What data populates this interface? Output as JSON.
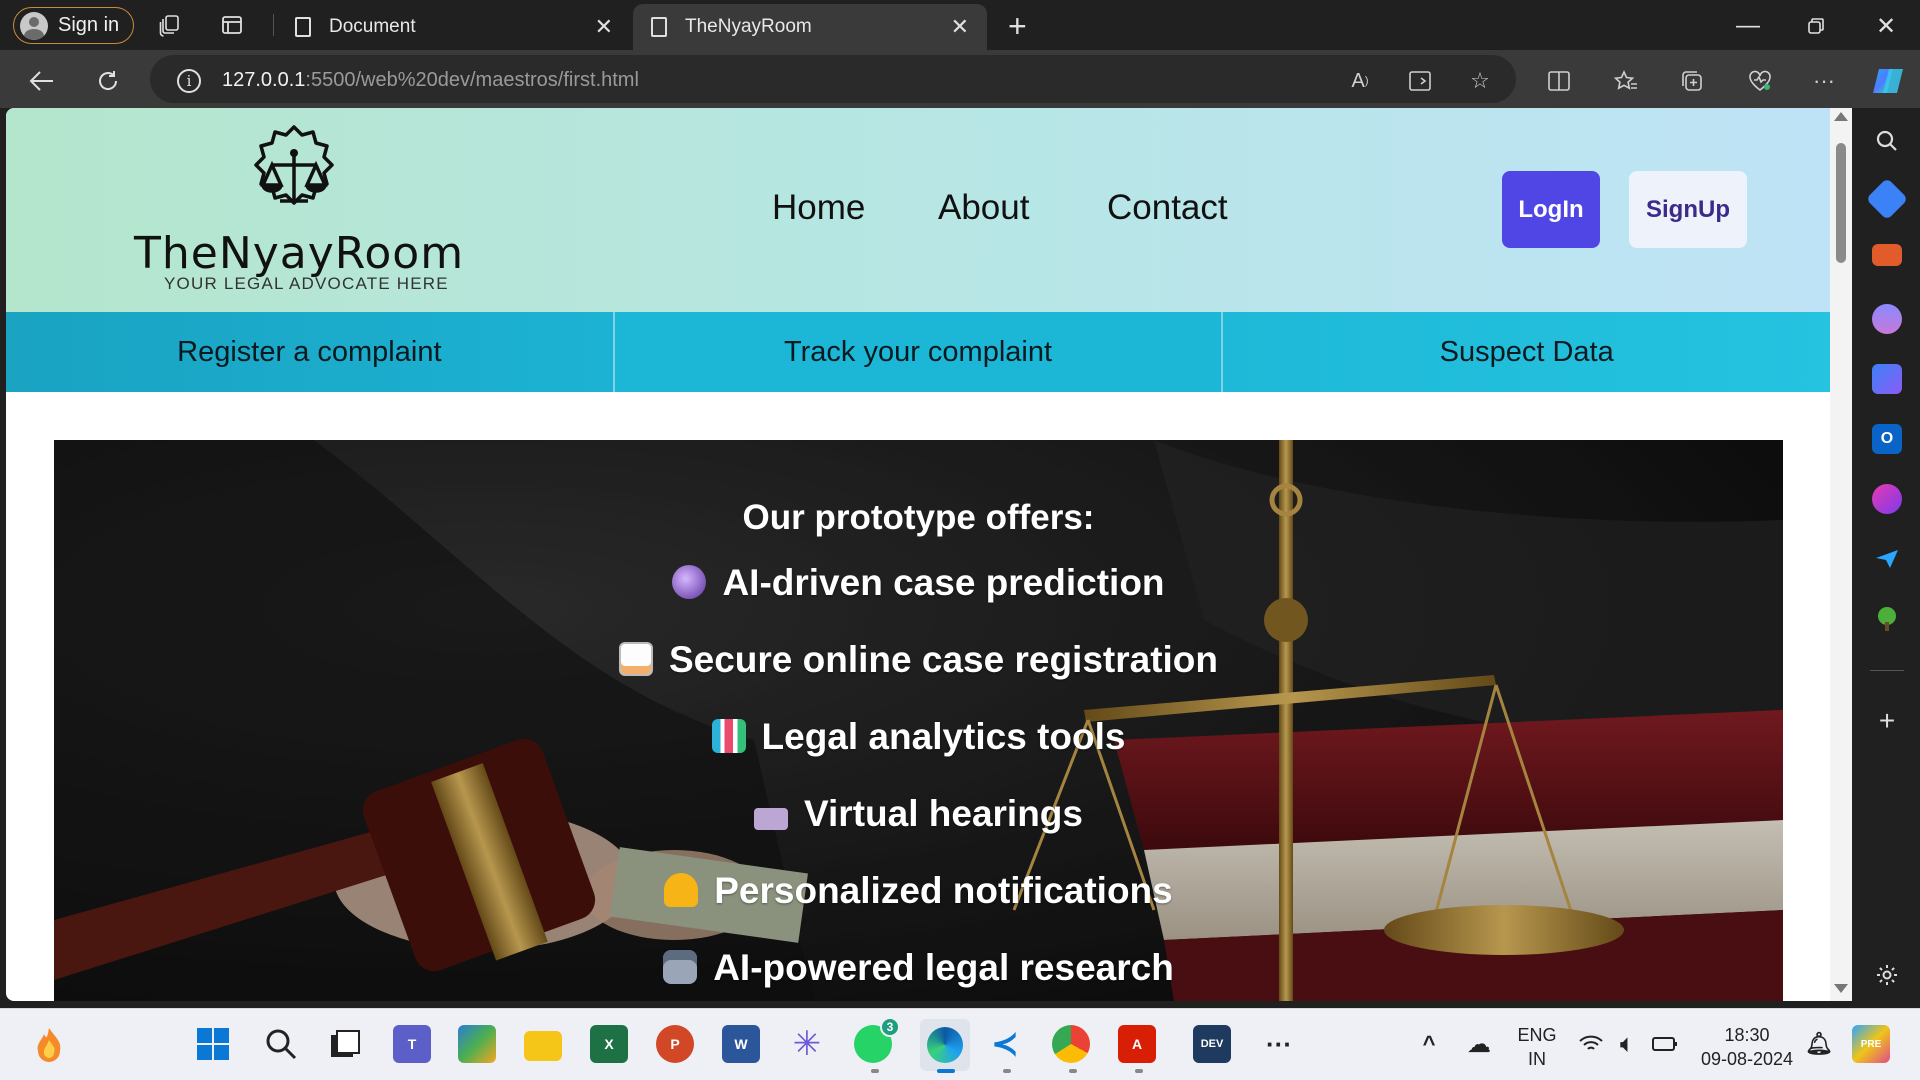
{
  "browser": {
    "profile_label": "Sign in",
    "tabs": [
      {
        "title": "Document",
        "active": false
      },
      {
        "title": "TheNyayRoom",
        "active": true
      }
    ],
    "url_host": "127.0.0.1",
    "url_path": ":5500/web%20dev/maestros/first.html"
  },
  "site": {
    "brand_name": "TheNyayRoom",
    "brand_tagline": "YOUR LEGAL ADVOCATE HERE",
    "nav": [
      "Home",
      "About",
      "Contact"
    ],
    "login_label": "LogIn",
    "signup_label": "SignUp",
    "login_color": "#4f46e5",
    "subnav": [
      "Register a complaint",
      "Track your complaint",
      "Suspect Data"
    ],
    "hero_title": "Our prototype offers:",
    "features": [
      {
        "icon": "crystal-ball-icon",
        "text": "AI-driven case prediction"
      },
      {
        "icon": "memo-icon",
        "text": "Secure online case registration"
      },
      {
        "icon": "bar-chart-icon",
        "text": "Legal analytics tools"
      },
      {
        "icon": "video-camera-icon",
        "text": "Virtual hearings"
      },
      {
        "icon": "bell-icon",
        "text": "Personalized notifications"
      },
      {
        "icon": "robot-icon",
        "text": "AI-powered legal research"
      }
    ]
  },
  "taskbar": {
    "whatsapp_badge": "3",
    "lang_line1": "ENG",
    "lang_line2": "IN",
    "time": "18:30",
    "date": "09-08-2024"
  }
}
